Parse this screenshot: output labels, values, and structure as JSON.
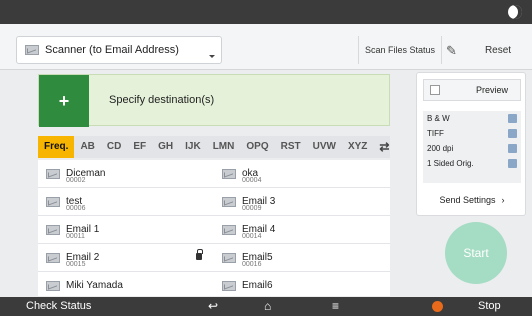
{
  "header": {
    "function_select": "Scanner (to Email Address)",
    "scan_files_status": "Scan Files Status",
    "reset": "Reset"
  },
  "destination": {
    "plus": "+",
    "label": "Specify destination(s)"
  },
  "tabs": [
    "Freq.",
    "AB",
    "CD",
    "EF",
    "GH",
    "IJK",
    "LMN",
    "OPQ",
    "RST",
    "UVW",
    "XYZ"
  ],
  "addresses": [
    {
      "name": "Diceman",
      "num": "00002"
    },
    {
      "name": "oka",
      "num": "00004"
    },
    {
      "name": "test",
      "num": "00006"
    },
    {
      "name": "Email 3",
      "num": "00009"
    },
    {
      "name": "Email 1",
      "num": "00011"
    },
    {
      "name": "Email 4",
      "num": "00014"
    },
    {
      "name": "Email 2",
      "num": "00015"
    },
    {
      "name": "Email5",
      "num": "00016"
    },
    {
      "name": "Miki Yamada",
      "num": ""
    },
    {
      "name": "Email6",
      "num": ""
    }
  ],
  "side": {
    "preview": "Preview",
    "settings": [
      "B & W",
      "TIFF",
      "200 dpi",
      "1 Sided Orig."
    ],
    "send_settings": "Send Settings"
  },
  "start": "Start",
  "footer": {
    "check_status": "Check Status",
    "stop": "Stop"
  }
}
